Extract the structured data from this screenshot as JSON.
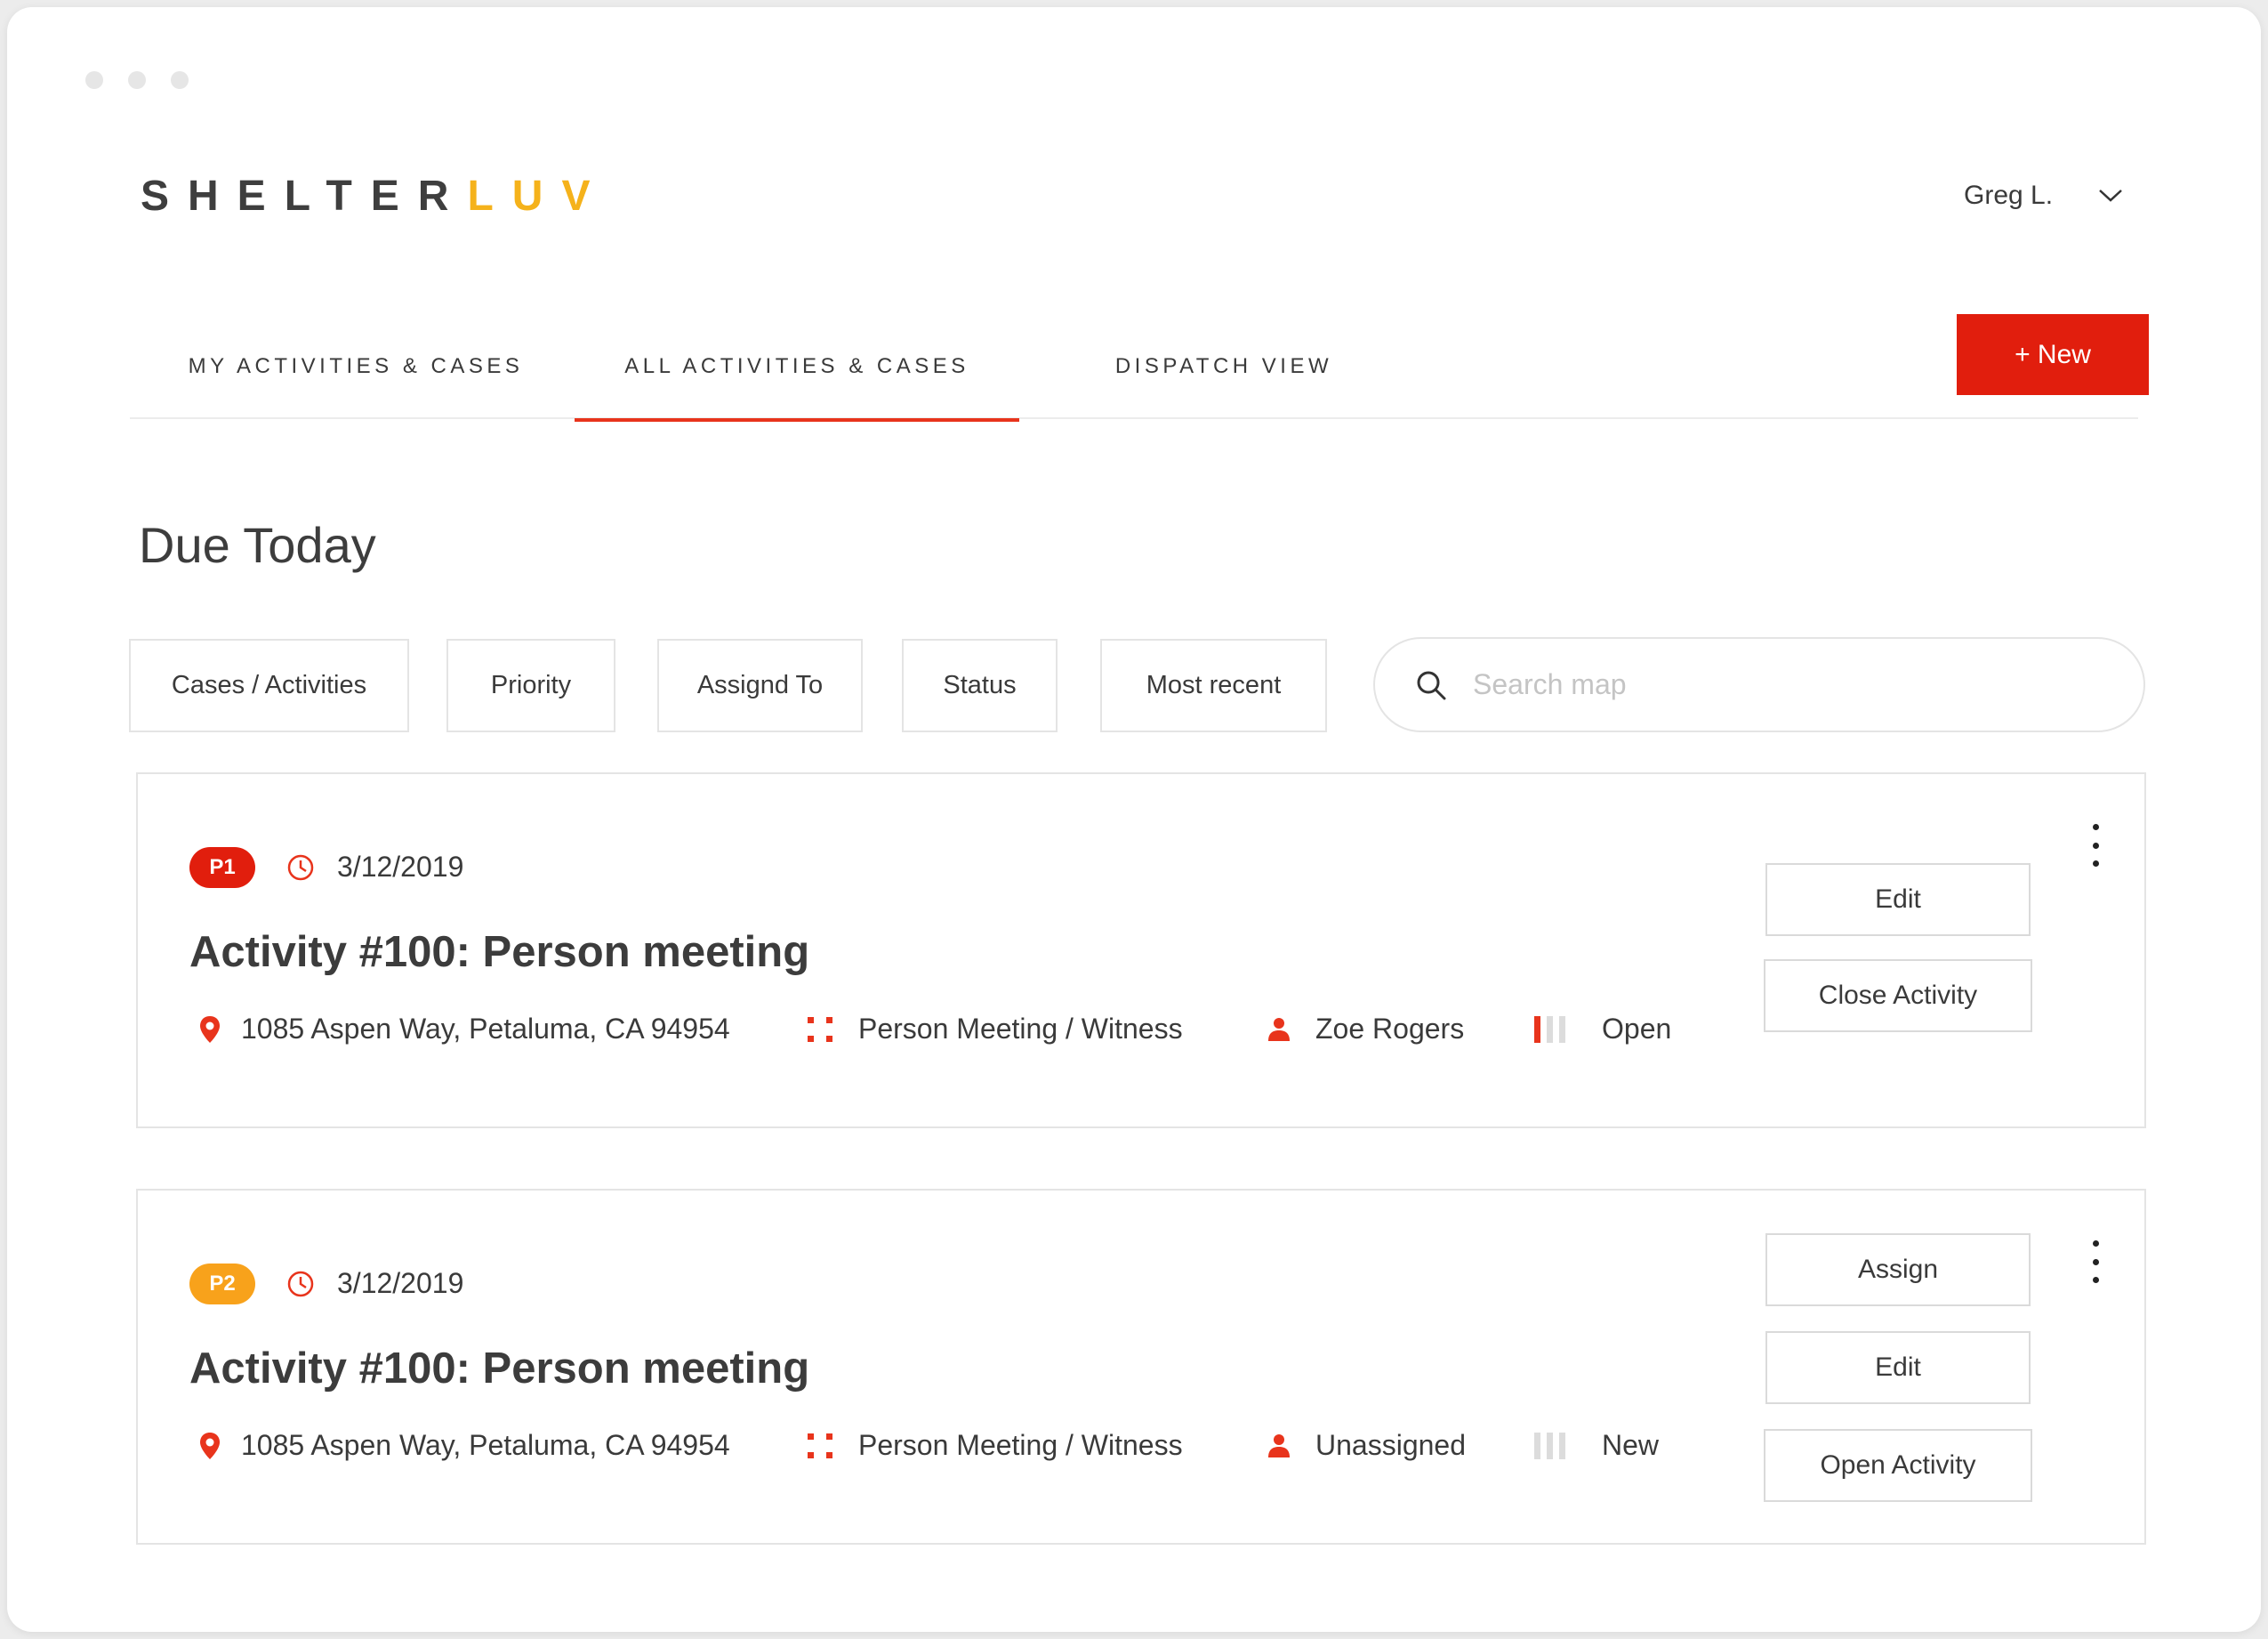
{
  "logo": {
    "part1": "SHELTER",
    "part2": "LUV"
  },
  "user": {
    "name": "Greg L."
  },
  "tabs": [
    {
      "label": "MY ACTIVITIES & CASES",
      "active": false
    },
    {
      "label": "ALL ACTIVITIES & CASES",
      "active": true
    },
    {
      "label": "DISPATCH VIEW",
      "active": false
    }
  ],
  "new_button": "+ New",
  "page_title": "Due Today",
  "filters": [
    "Cases / Activities",
    "Priority",
    "Assignd To",
    "Status",
    "Most recent"
  ],
  "search": {
    "placeholder": "Search map"
  },
  "cards": [
    {
      "priority": "P1",
      "date": "3/12/2019",
      "title": "Activity #100: Person meeting",
      "address": "1085 Aspen Way, Petaluma, CA 94954",
      "type": "Person Meeting / Witness",
      "assignee": "Zoe Rogers",
      "status": "Open",
      "status_level": 1,
      "buttons": [
        "Edit",
        "Close Activity"
      ]
    },
    {
      "priority": "P2",
      "date": "3/12/2019",
      "title": "Activity #100: Person meeting",
      "address": "1085 Aspen Way, Petaluma, CA 94954",
      "type": "Person Meeting / Witness",
      "assignee": "Unassigned",
      "status": "New",
      "status_level": 0,
      "buttons": [
        "Assign",
        "Edit",
        "Open Activity"
      ]
    }
  ],
  "colors": {
    "accent": "#e11e0d",
    "logo_yellow": "#f5b21b",
    "p1": "#e11e0d",
    "p2": "#f8a21b",
    "icon_red": "#e8341c"
  }
}
